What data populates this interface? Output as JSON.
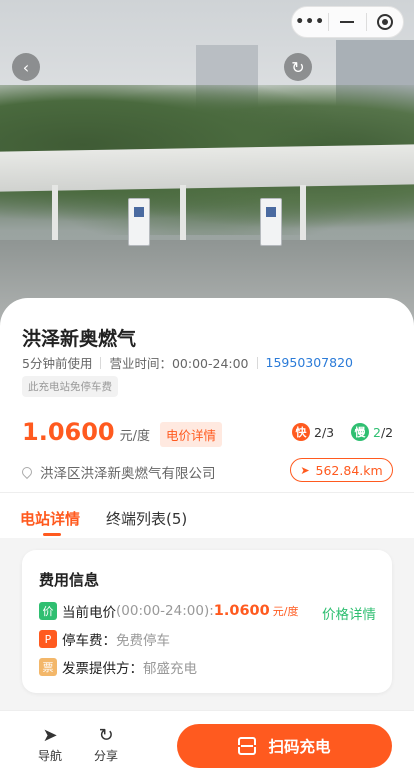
{
  "capsule": {
    "more_icon": "more-dots-icon",
    "minimize_icon": "minimize-icon",
    "close_icon": "target-close-icon"
  },
  "hero": {
    "back_icon": "back-chevron-icon",
    "refresh_icon": "refresh-icon"
  },
  "station": {
    "name": "洪泽新奥燃气",
    "last_used": "5分钟前使用",
    "hours": "营业时间：00:00-24:00",
    "phone": "15950307820",
    "parking_tag": "此充电站免停车费",
    "price": "1.0600",
    "price_unit": "元/度",
    "price_detail_label": "电价详情",
    "fast": {
      "icon_text": "快",
      "count": "2/3"
    },
    "slow": {
      "icon_text": "慢",
      "available": "2",
      "total_suffix": "/2"
    },
    "address": "洪泽区洪泽新奥燃气有限公司",
    "distance": "562.84.km"
  },
  "tabs": [
    {
      "label": "电站详情",
      "active": true
    },
    {
      "label": "终端列表(5)",
      "active": false
    }
  ],
  "fee": {
    "title": "费用信息",
    "current_price": {
      "icon_text": "价",
      "label": "当前电价",
      "period": "(00:00-24:00):",
      "value": "1.0600",
      "unit": "元/度"
    },
    "price_detail_link": "价格详情",
    "parking": {
      "icon_text": "P",
      "label": "停车费：",
      "value": "免费停车"
    },
    "invoice": {
      "icon_text": "票",
      "label": "发票提供方：",
      "value": "郁盛充电"
    }
  },
  "bottom": {
    "nav_label": "导航",
    "share_label": "分享",
    "scan_label": "扫码充电"
  },
  "colors": {
    "accent": "#ff5a1f",
    "green": "#2fbf71",
    "link": "#2b7bd8"
  }
}
